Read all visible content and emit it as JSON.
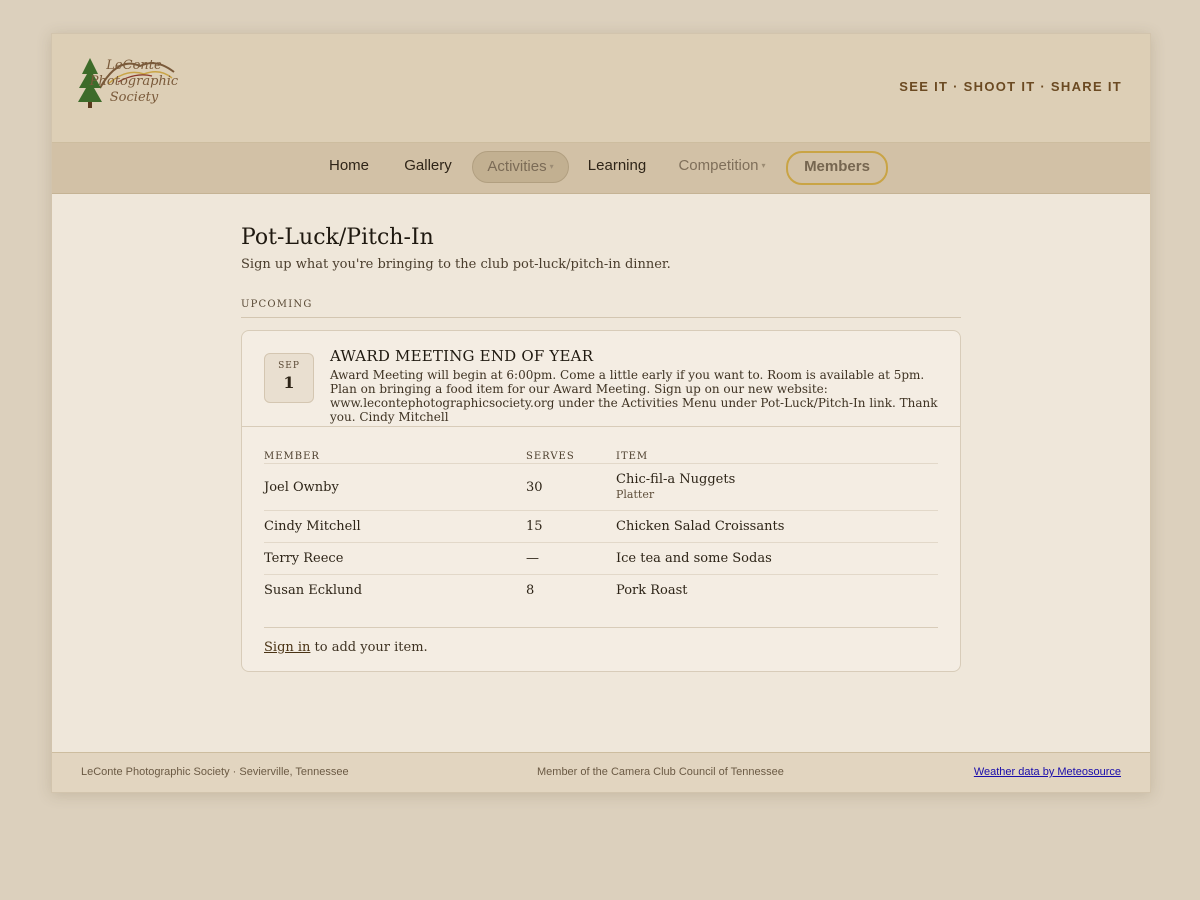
{
  "header": {
    "logo_text": [
      "LeConte",
      "Photographic",
      "Society"
    ],
    "tagline": "SEE IT · SHOOT IT · SHARE IT"
  },
  "nav": {
    "home": "Home",
    "gallery": "Gallery",
    "activities": "Activities",
    "learning": "Learning",
    "competition": "Competition",
    "members": "Members",
    "active_item": "Activities"
  },
  "page": {
    "title": "Pot-Luck/Pitch-In",
    "subtitle": "Sign up what you're bringing to the club pot-luck/pitch-in dinner.",
    "section_label": "UPCOMING"
  },
  "event": {
    "month": "SEP",
    "day": "1",
    "title": "AWARD MEETING END OF YEAR",
    "description": "Award Meeting will begin at 6:00pm. Come a little early if you want to. Room is available at 5pm. Plan on bringing a food item for our Award Meeting. Sign up on our new website: www.lecontephotographicsociety.org under the Activities Menu under Pot-Luck/Pitch-In link. Thank you. Cindy Mitchell"
  },
  "table": {
    "headers": {
      "member": "MEMBER",
      "serves": "SERVES",
      "item": "ITEM"
    },
    "rows": [
      {
        "member": "Joel Ownby",
        "serves": "30",
        "item": "Chic-fil-a Nuggets",
        "note": "Platter"
      },
      {
        "member": "Cindy Mitchell",
        "serves": "15",
        "item": "Chicken Salad Croissants",
        "note": ""
      },
      {
        "member": "Terry Reece",
        "serves": "—",
        "item": "Ice tea and some Sodas",
        "note": ""
      },
      {
        "member": "Susan Ecklund",
        "serves": "8",
        "item": "Pork Roast",
        "note": ""
      }
    ]
  },
  "signin": {
    "link": "Sign in",
    "rest": " to add your item."
  },
  "footer": {
    "left": "LeConte Photographic Society · Sevierville, Tennessee",
    "middle": "Member of the Camera Club Council of Tennessee",
    "right": "Weather data by Meteosource"
  },
  "colors": {
    "accent": "#c9a445",
    "nav_bg": "#d2c1a6",
    "page_bg": "#efe7da",
    "link": "#1a0dab"
  }
}
